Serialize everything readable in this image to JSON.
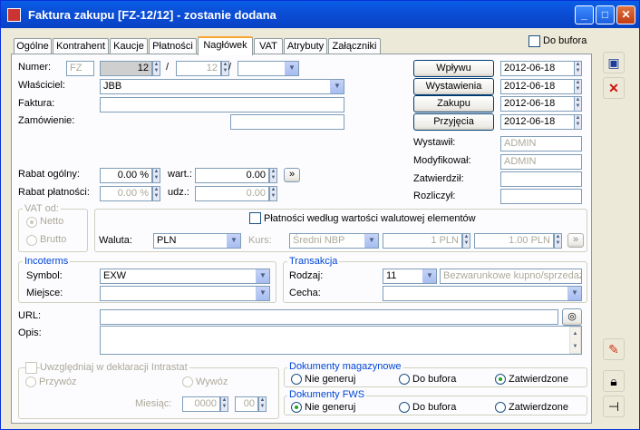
{
  "window": {
    "title": "Faktura zakupu [FZ-12/12]  - zostanie dodana"
  },
  "tabs": [
    "Ogólne",
    "Kontrahent",
    "Kaucje",
    "Płatności",
    "Nagłówek",
    "VAT",
    "Atrybuty",
    "Załączniki"
  ],
  "active_tab": "Nagłówek",
  "do_bufora": {
    "label": "Do bufora",
    "checked": false
  },
  "numer": {
    "label": "Numer:",
    "prefix": "FZ",
    "number": "12",
    "month": "12",
    "sep": "/"
  },
  "wlasciciel": {
    "label": "Właściciel:",
    "value": "JBB"
  },
  "faktura": {
    "label": "Faktura:",
    "value": ""
  },
  "zamowienie": {
    "label": "Zamówienie:",
    "value": ""
  },
  "dates": [
    {
      "label": "Wpływu",
      "value": "2012-06-18"
    },
    {
      "label": "Wystawienia",
      "value": "2012-06-18"
    },
    {
      "label": "Zakupu",
      "value": "2012-06-18"
    },
    {
      "label": "Przyjęcia",
      "value": "2012-06-18"
    }
  ],
  "persons": [
    {
      "label": "Wystawił:",
      "value": "ADMIN"
    },
    {
      "label": "Modyfikował:",
      "value": "ADMIN"
    },
    {
      "label": "Zatwierdził:",
      "value": ""
    },
    {
      "label": "Rozliczył:",
      "value": ""
    }
  ],
  "rabat_ogolny": {
    "label": "Rabat ogólny:",
    "value": "0.00 %",
    "wart_label": "wart.:",
    "wart_value": "0.00"
  },
  "rabat_platnosci": {
    "label": "Rabat płatności:",
    "value": "0.00 %",
    "udz_label": "udz.:",
    "udz_value": "0.00"
  },
  "vat_od": {
    "label": "VAT od:",
    "netto": "Netto",
    "brutto": "Brutto",
    "selected": "Netto"
  },
  "platnosci_walutowe": {
    "label": "Płatności według wartości walutowej elementów",
    "checked": false
  },
  "waluta": {
    "label": "Waluta:",
    "value": "PLN",
    "kurs_label": "Kurs:",
    "kurs_type": "Średni NBP",
    "rate1": "1 PLN",
    "rate2": "1.00 PLN"
  },
  "incoterms": {
    "label": "Incoterms",
    "symbol_label": "Symbol:",
    "symbol_value": "EXW",
    "miejsce_label": "Miejsce:",
    "miejsce_value": ""
  },
  "transakcja": {
    "label": "Transakcja",
    "rodzaj_label": "Rodzaj:",
    "rodzaj_value": "11",
    "rodzaj_desc": "Bezwarunkowe kupno/sprzedaż",
    "cecha_label": "Cecha:",
    "cecha_value": ""
  },
  "url": {
    "label": "URL:",
    "value": ""
  },
  "opis": {
    "label": "Opis:",
    "value": ""
  },
  "intrastat": {
    "label": "Uwzględniaj w deklaracji Intrastat",
    "przywoz": "Przywóz",
    "wywoz": "Wywóz",
    "miesiac_label": "Miesiąc:",
    "year": "0000",
    "month": "00"
  },
  "dok_mag": {
    "label": "Dokumenty magazynowe",
    "options": [
      "Nie generuj",
      "Do bufora",
      "Zatwierdzone"
    ],
    "selected": "Zatwierdzone"
  },
  "dok_fws": {
    "label": "Dokumenty FWS",
    "options": [
      "Nie generuj",
      "Do bufora",
      "Zatwierdzone"
    ],
    "selected": "Nie generuj"
  },
  "colors": {
    "titlebar": "#0b4fd8",
    "accent": "#0046d5",
    "tab_highlight": "#f7a531"
  }
}
